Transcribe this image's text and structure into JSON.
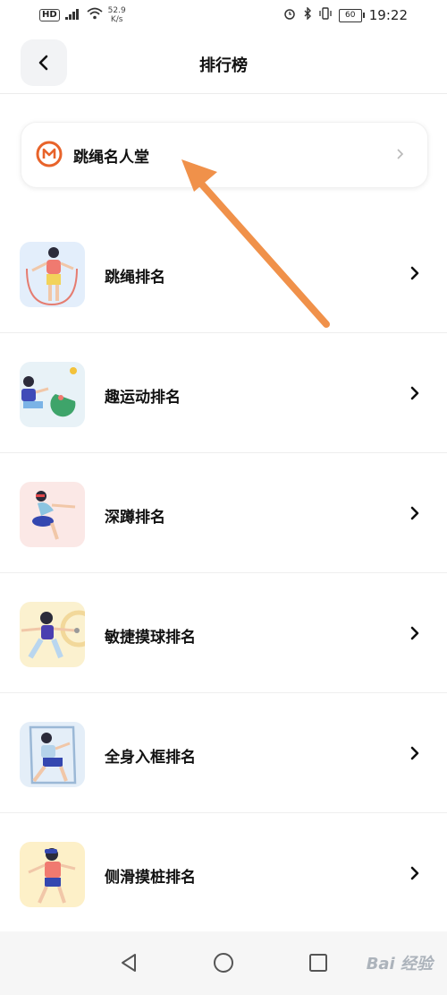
{
  "status_bar": {
    "hd": "HD",
    "net_speed_value": "52.9",
    "net_speed_unit": "K/s",
    "battery": "60",
    "time": "19:22"
  },
  "header": {
    "title": "排行榜"
  },
  "hall_of_fame": {
    "label": "跳绳名人堂"
  },
  "rankings": [
    {
      "label": "跳绳排名",
      "icon": "jump-rope-illustration-icon"
    },
    {
      "label": "趣运动排名",
      "icon": "fun-sports-illustration-icon"
    },
    {
      "label": "深蹲排名",
      "icon": "squat-illustration-icon"
    },
    {
      "label": "敏捷摸球排名",
      "icon": "agility-ball-illustration-icon"
    },
    {
      "label": "全身入框排名",
      "icon": "full-body-frame-illustration-icon"
    },
    {
      "label": "侧滑摸桩排名",
      "icon": "side-slide-illustration-icon"
    }
  ],
  "watermark": "Bai 经验",
  "colors": {
    "accent_orange": "#e8632a",
    "arrow": "#f0914a",
    "card_bg": "#ffffff"
  }
}
